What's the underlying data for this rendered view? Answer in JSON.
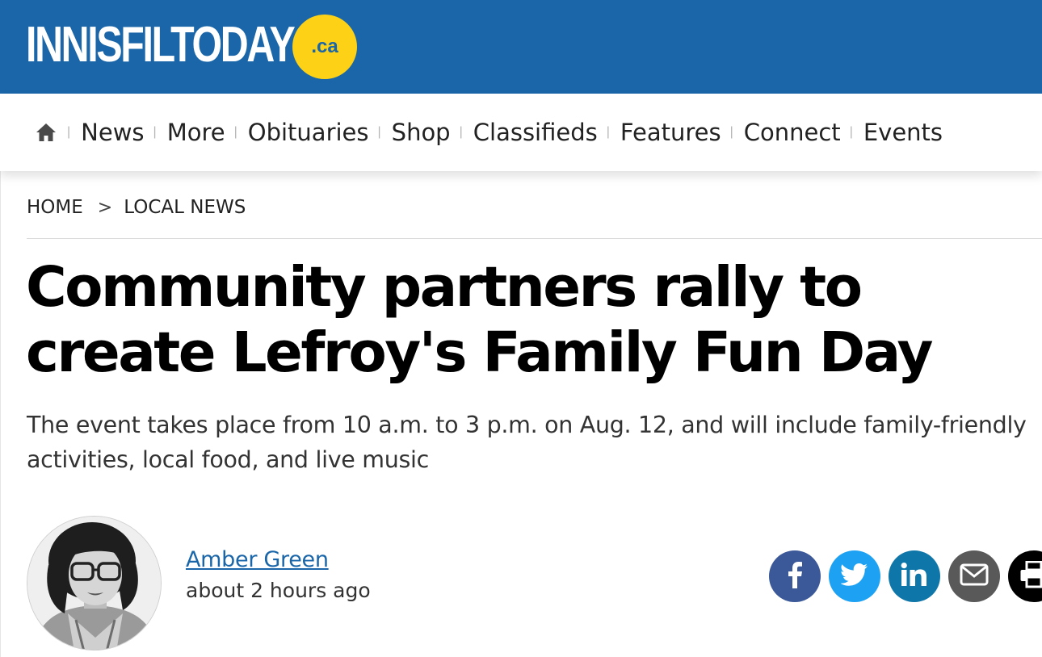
{
  "site": {
    "logo_text": "INNISFILTODAY",
    "logo_badge": ".ca",
    "brand_color": "#1a66a8",
    "badge_color": "#fcd116"
  },
  "nav": {
    "home_icon": "home-icon",
    "items": [
      "News",
      "More",
      "Obituaries",
      "Shop",
      "Classifieds",
      "Features",
      "Connect",
      "Events"
    ]
  },
  "breadcrumb": {
    "home": "HOME",
    "separator": ">",
    "section": "LOCAL NEWS"
  },
  "article": {
    "headline": "Community partners rally to create Lefroy's Family Fun Day",
    "dek": "The event takes place from 10 a.m. to 3 p.m. on Aug. 12, and will include family-friendly activities, local food, and live music",
    "author": "Amber Green",
    "time": "about 2 hours ago"
  },
  "share": {
    "icons": [
      "facebook-icon",
      "twitter-icon",
      "linkedin-icon",
      "email-icon",
      "print-icon"
    ],
    "colors": {
      "facebook": "#3b5998",
      "twitter": "#1da1f2",
      "linkedin": "#0e76a8",
      "email": "#595959",
      "print": "#000000"
    }
  }
}
